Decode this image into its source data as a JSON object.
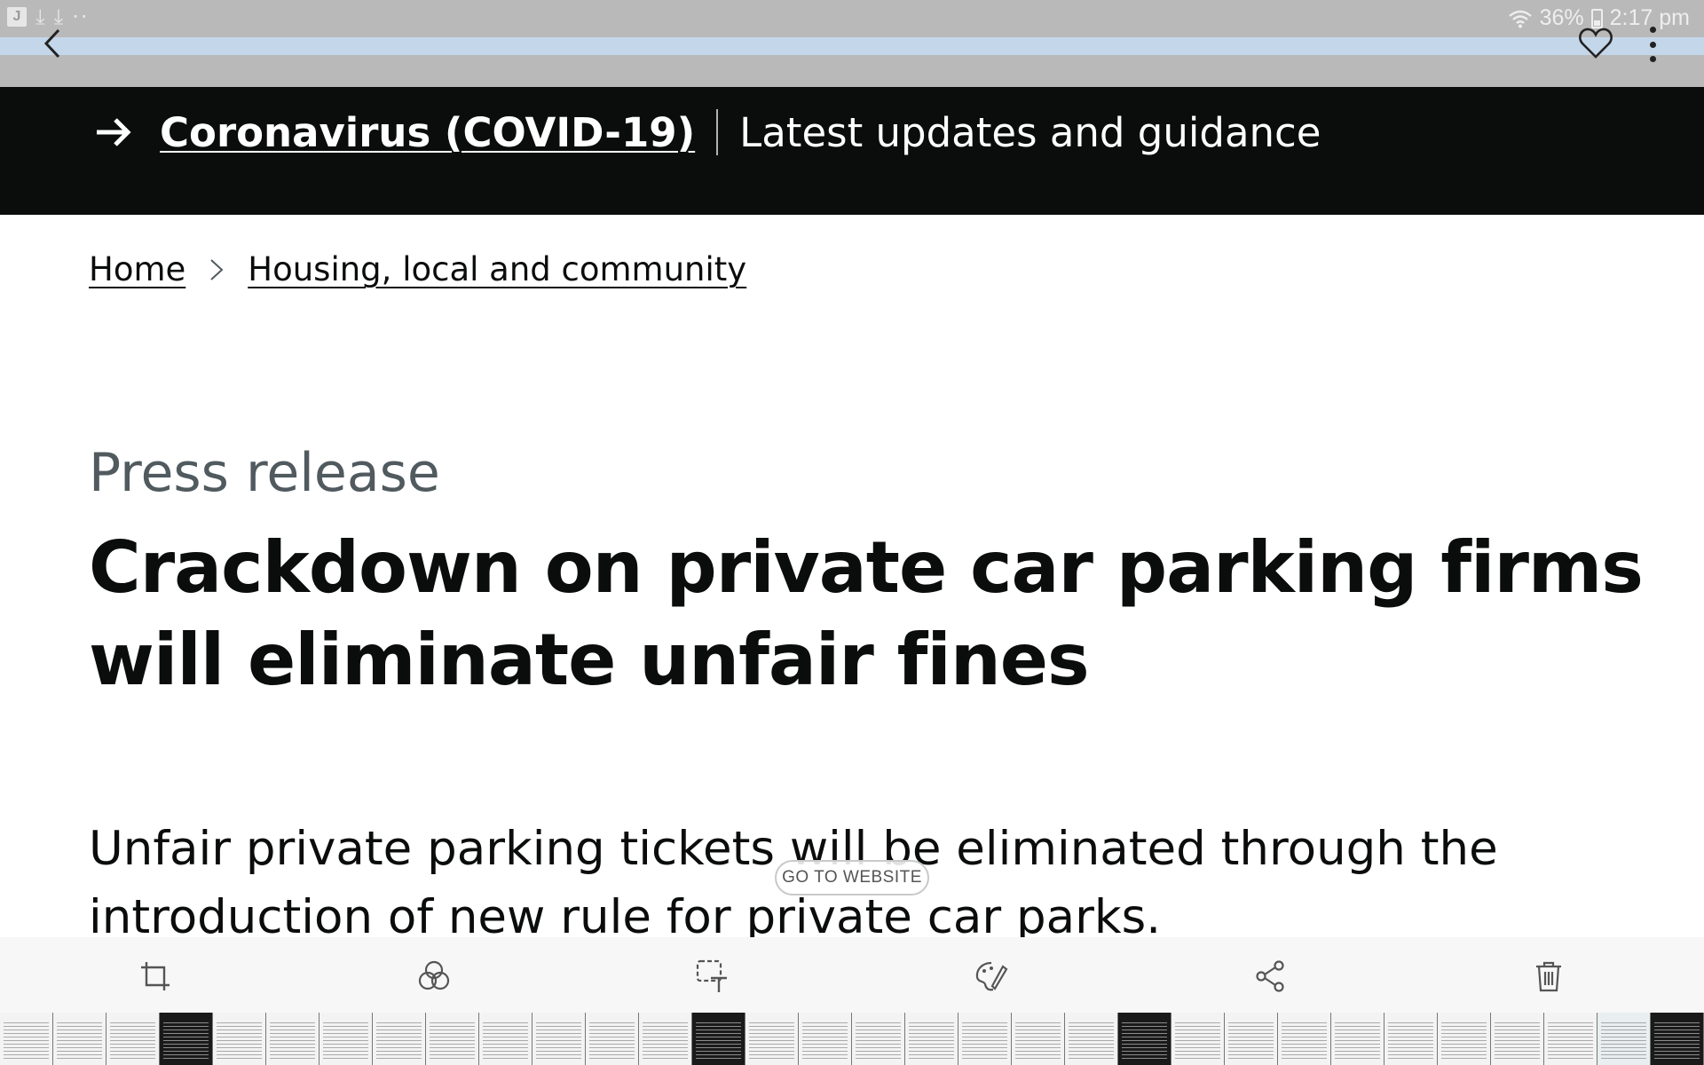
{
  "status_bar": {
    "battery": "36%",
    "time": "2:17 pm",
    "left_icons": [
      "notification-app-icon",
      "download-icon",
      "download-icon",
      "more-dots-icon"
    ]
  },
  "browser": {
    "icons": [
      "back-icon",
      "heart-icon",
      "more-vertical-icon"
    ]
  },
  "banner": {
    "link_text": "Coronavirus (COVID-19)",
    "text": "Latest updates and guidance",
    "background": "#0b0c0c"
  },
  "breadcrumb": {
    "items": [
      "Home",
      "Housing, local and community"
    ]
  },
  "article": {
    "caption": "Press release",
    "title": "Crackdown on private car parking firms will eliminate unfair fines",
    "lede": "Unfair private parking tickets will be eliminated through the introduction of new rule for private car parks."
  },
  "overlay": {
    "go_to_website": "GO TO WEBSITE"
  },
  "toolbar": {
    "tools": [
      "crop-rotate-icon",
      "filter-icon",
      "text-extract-icon",
      "paint-icon",
      "share-icon",
      "trash-icon"
    ]
  },
  "thumbnail_strip": {
    "count": 32
  }
}
